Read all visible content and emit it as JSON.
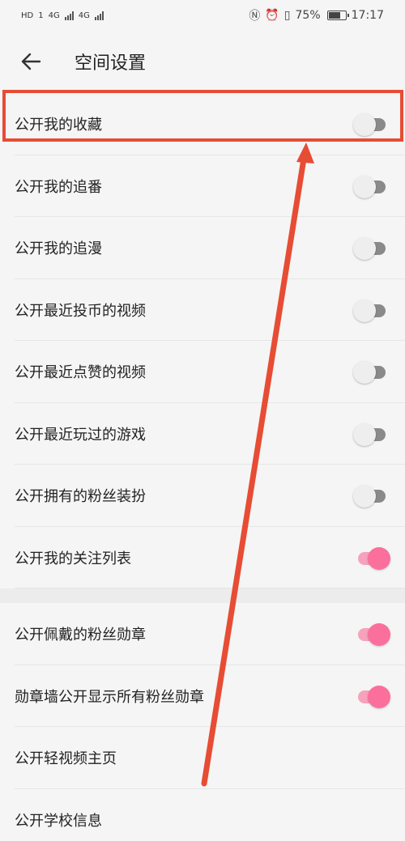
{
  "status_bar": {
    "left_badges": [
      "HD",
      "1",
      "4G",
      "4G"
    ],
    "battery_percent": "75%",
    "battery_level": 0.75,
    "time": "17:17"
  },
  "header": {
    "title": "空间设置",
    "back_icon": "arrow-left-icon"
  },
  "settings": [
    {
      "label": "公开我的收藏",
      "enabled": false
    },
    {
      "label": "公开我的追番",
      "enabled": false
    },
    {
      "label": "公开我的追漫",
      "enabled": false
    },
    {
      "label": "公开最近投币的视频",
      "enabled": false
    },
    {
      "label": "公开最近点赞的视频",
      "enabled": false
    },
    {
      "label": "公开最近玩过的游戏",
      "enabled": false
    },
    {
      "label": "公开拥有的粉丝装扮",
      "enabled": false
    },
    {
      "label": "公开我的关注列表",
      "enabled": true
    },
    {
      "label": "公开佩戴的粉丝勋章",
      "enabled": true
    },
    {
      "label": "勋章墙公开显示所有粉丝勋章",
      "enabled": true
    },
    {
      "label": "公开轻视频主页",
      "enabled": null
    },
    {
      "label": "公开学校信息",
      "enabled": null
    }
  ],
  "colors": {
    "accent": "#fb6f9c",
    "annotation": "#e74c34",
    "toggle_off_track": "#8a8a8a"
  }
}
